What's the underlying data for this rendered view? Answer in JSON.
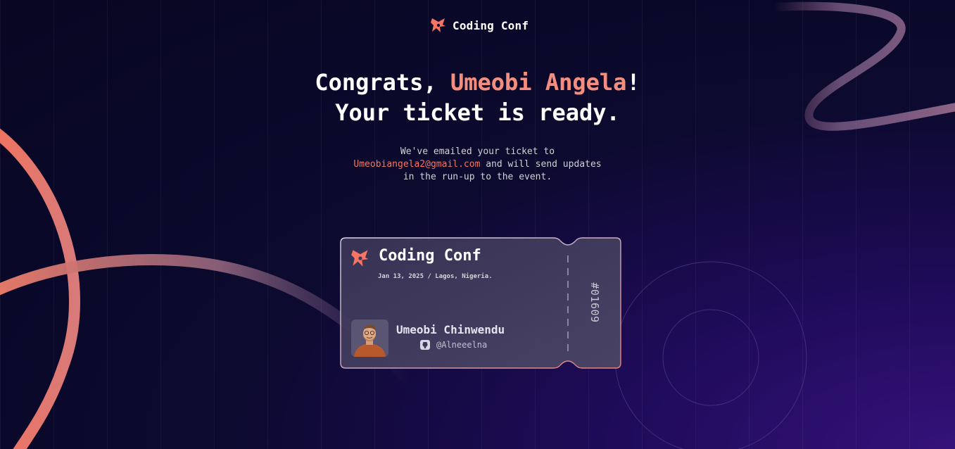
{
  "brand": {
    "name": "Coding Conf",
    "icon": "coding-conf-logo-icon",
    "accent_color": "#f57463"
  },
  "headline": {
    "prefix": "Congrats, ",
    "name": "Umeobi Angela",
    "suffix": "!",
    "line2": "Your ticket is ready."
  },
  "message": {
    "line1": "We've emailed your ticket to",
    "email": "Umeobiangela2@gmail.com",
    "after_email": " and will send updates",
    "line3": "in the run-up to the event."
  },
  "ticket": {
    "title": "Coding Conf",
    "meta": "Jan 13, 2025 / Lagos, Nigeria.",
    "attendee_name": "Umeobi Chinwendu",
    "github_handle": "@Alneeelna",
    "ticket_number": "#01609",
    "avatar": "attendee-avatar"
  }
}
